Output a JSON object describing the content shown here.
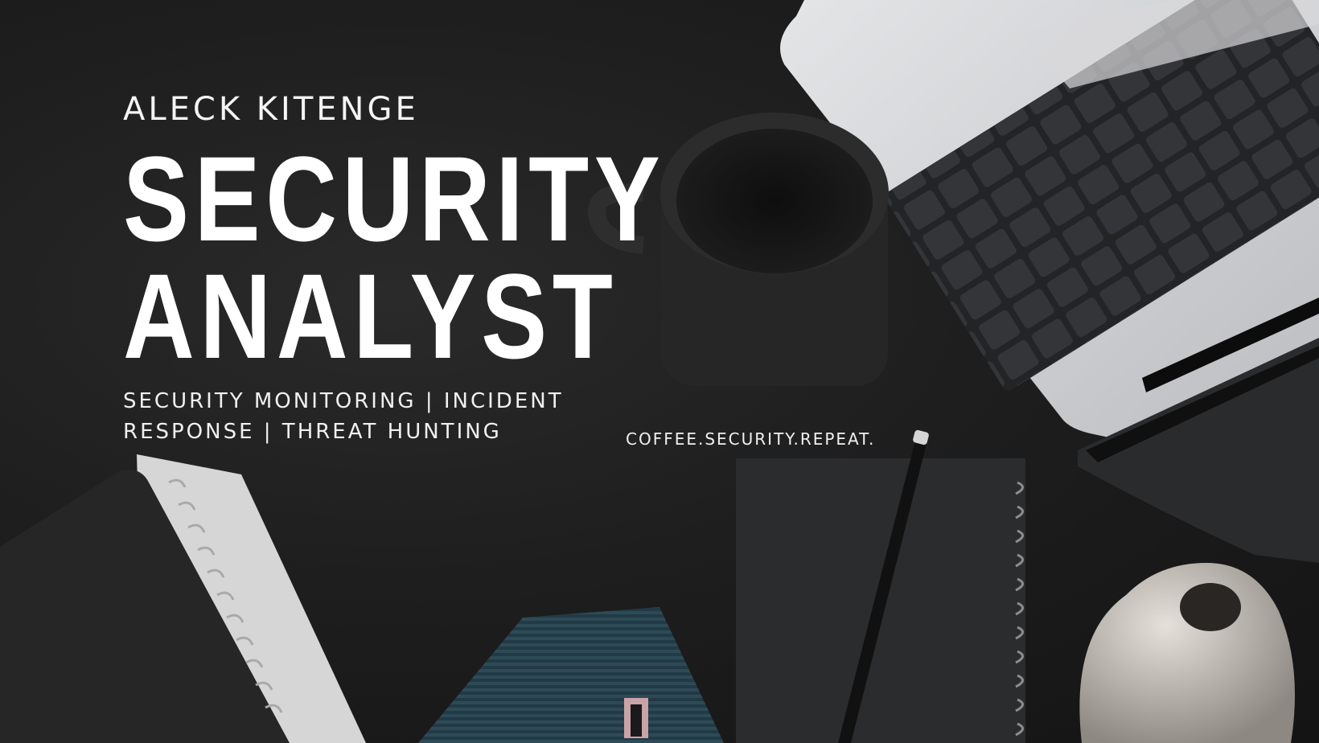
{
  "hero": {
    "name": "ALECK KITENGE",
    "title_line1": "SECURITY",
    "title_line2": "ANALYST",
    "subtitle_line1": "SECURITY MONITORING | INCIDENT",
    "subtitle_line2": "RESPONSE | THREAT HUNTING",
    "tagline": "COFFEE.SECURITY.REPEAT."
  },
  "colors": {
    "background": "#1a1a1a",
    "text": "#ffffff",
    "laptop": "#c9cbcd",
    "keys": "#3a3b3d"
  },
  "photo_objects": [
    "coffee-mug",
    "laptop",
    "notebooks",
    "pencil",
    "vase",
    "house-model"
  ]
}
